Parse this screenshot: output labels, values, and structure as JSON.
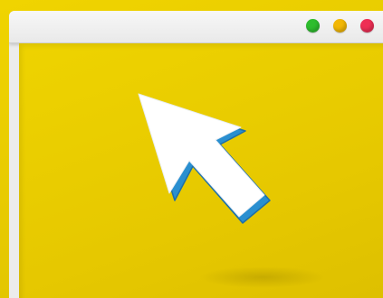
{
  "scene": {
    "background_color": "#e8cb00"
  },
  "window": {
    "frame_color": "#ececec",
    "controls": [
      {
        "name": "green-dot",
        "color": "#2ebd2e"
      },
      {
        "name": "yellow-dot",
        "color": "#f2b705"
      },
      {
        "name": "red-dot",
        "color": "#ee2f55"
      }
    ]
  },
  "cursor": {
    "icon": "mouse-pointer-arrow",
    "fill_color": "#ffffff",
    "edge_color": "#2a8fd0"
  }
}
